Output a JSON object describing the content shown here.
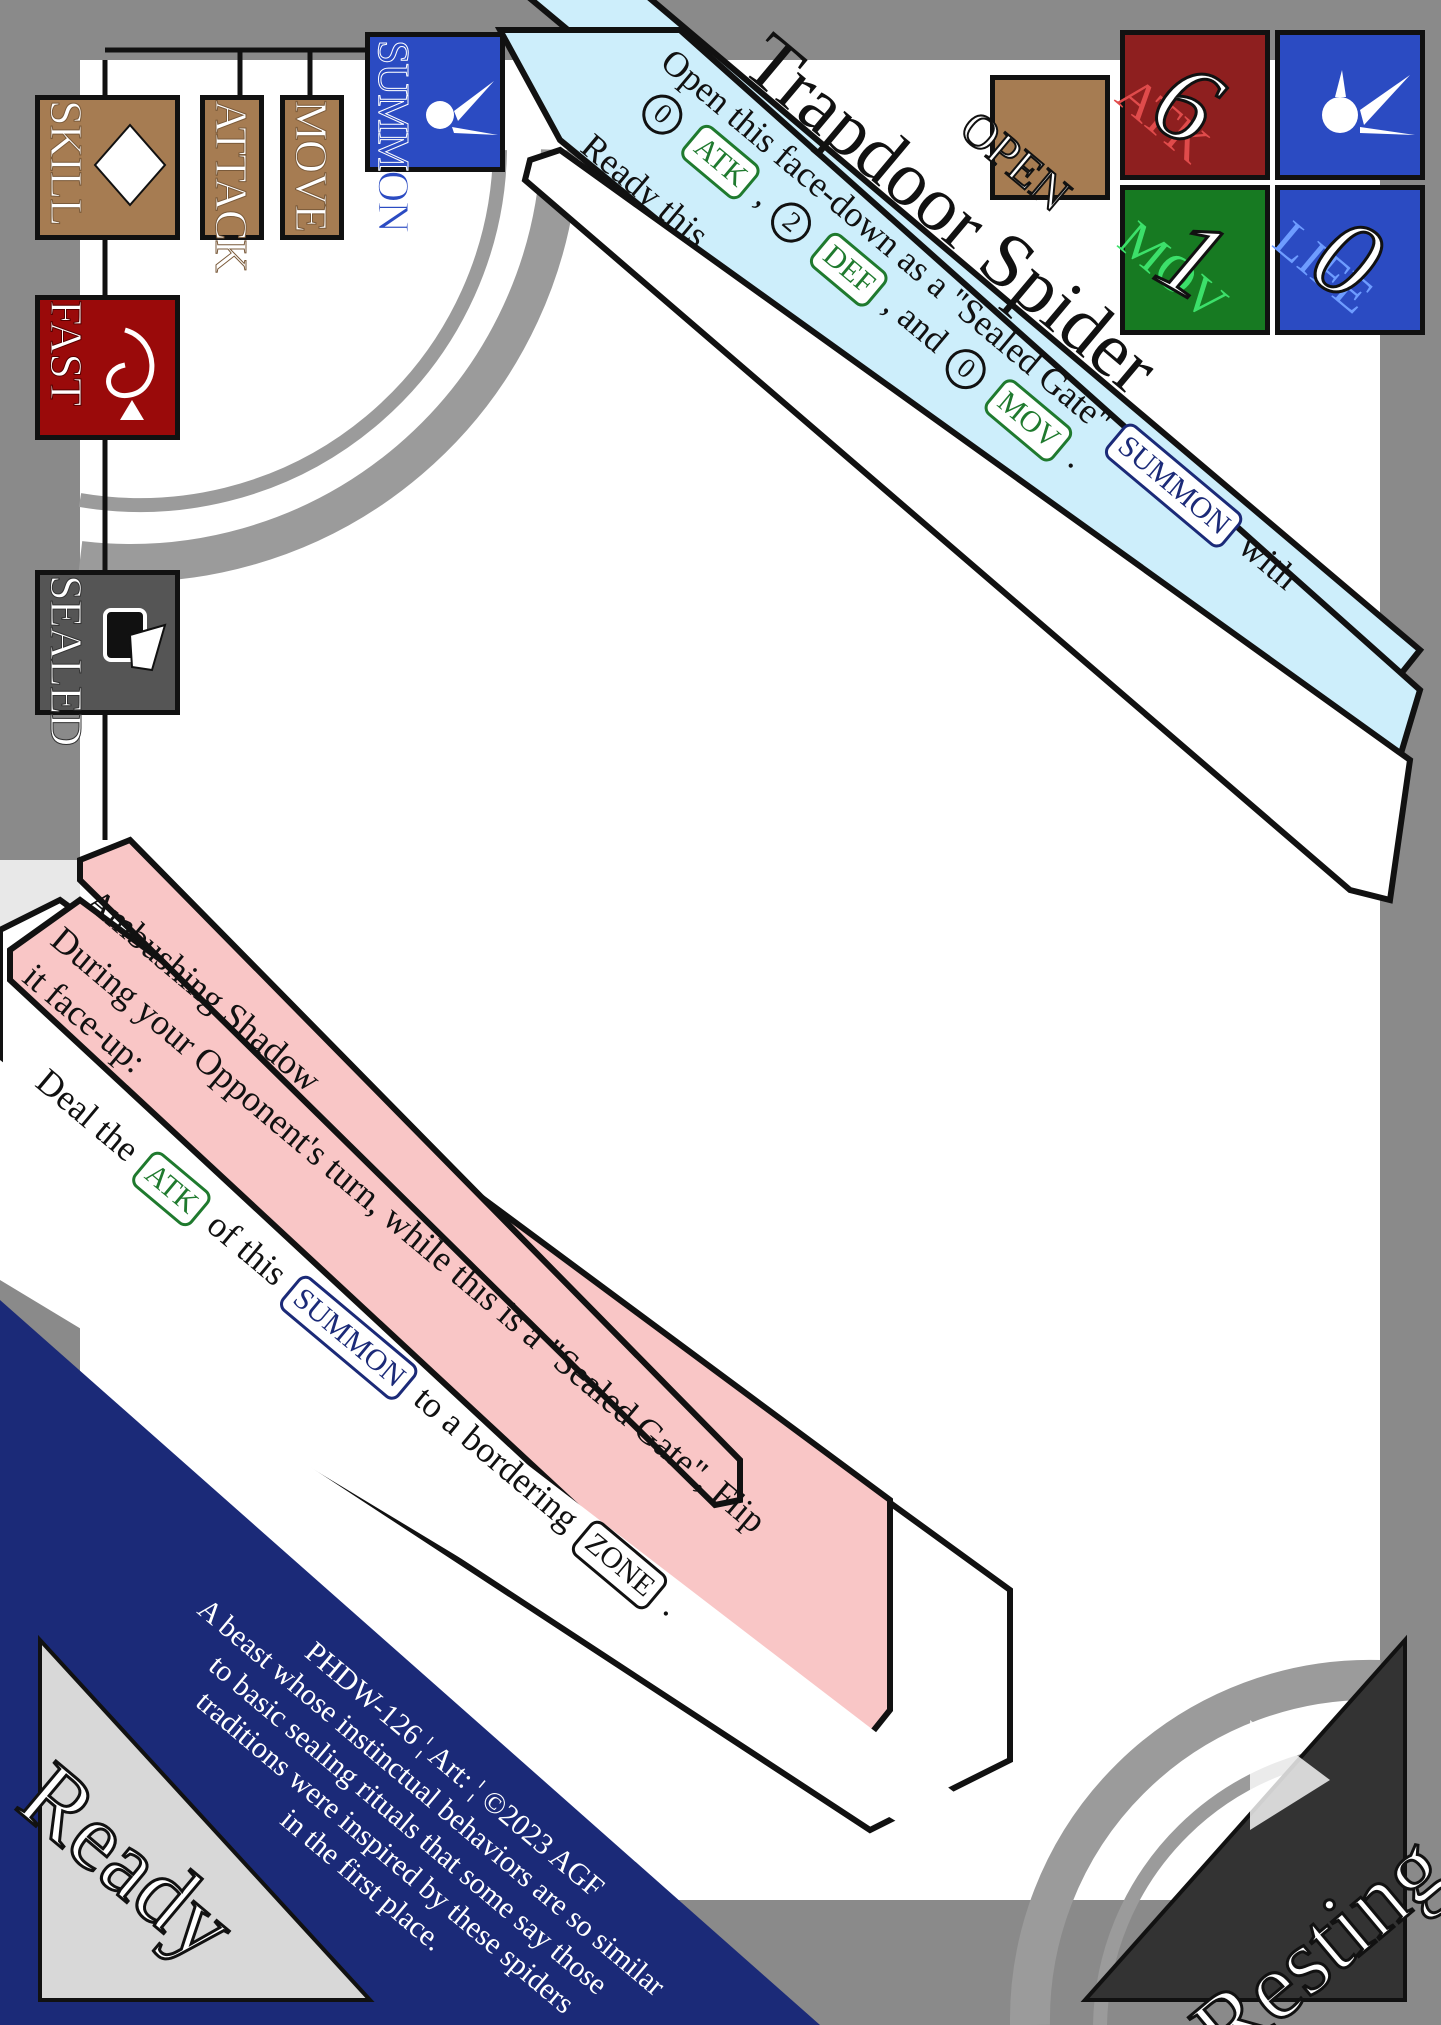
{
  "card": {
    "name": "Trapdoor Spider",
    "ribbon_text": "Open this face-down as a \"Sealed Gate\"",
    "ribbon_with": "with",
    "ribbon_cost_line": "ATK, DEF, and MOV.",
    "ribbon_numbers": [
      "0",
      "2",
      "0"
    ],
    "chip_labels": {
      "summon": "SUMMON",
      "atk": "ATK",
      "def": "DEF",
      "mov": "MOV",
      "zone": "ZONE"
    },
    "ribbon_sep": [
      ",",
      ", and",
      "."
    ],
    "ready_this": "Ready this.",
    "ability_name": "Ambushing Shadow",
    "ability_condition_1": "During your Opponent's turn, while this is a \"Sealed Gate\", Flip",
    "ability_condition_2": "it face-up:",
    "ability_effect_parts": [
      "Deal the",
      "of this",
      "to a bordering",
      "."
    ],
    "flavor": [
      "PHDW-126 ¦ Art: ¦ ©2023 AGF",
      "A beast whose instinctual behaviors are so similar",
      "to basic sealing rituals that some say those",
      "traditions were inspired by these spiders",
      "in the first place."
    ],
    "ready_label": "Ready",
    "resting_label": "Resting"
  },
  "stats": {
    "open_label": "OPEN",
    "atk_label": "ATK",
    "atk_value": "6",
    "mov_label": "MOV",
    "mov_value": "1",
    "life_label": "LIFE",
    "life_value": "0"
  },
  "phases": {
    "summon": "SUMMON",
    "move": "MOVE",
    "attack": "ATTACK",
    "skill": "SKILL",
    "fast": "FAST",
    "sealed": "SEALED"
  },
  "colors": {
    "frame": "#8a8a8a",
    "ribbon_blue": "#cdeefb",
    "ability_pink": "#f9c6c6",
    "ready_navy": "#1b2a78",
    "atk_red": "#8e1f1f",
    "mov_green": "#177a22",
    "life_blue": "#2b4bc2",
    "open_brown": "#a67c52",
    "skill_brown": "#a67c52",
    "fast_red": "#9a0a0a",
    "sealed_gray": "#555555",
    "chip_green": "#1f7a2e",
    "chip_navy": "#1b2a78"
  },
  "icons": [
    "summon-fairy-icon",
    "diamond-icon",
    "fast-swirl-icon",
    "sealed-card-icon",
    "triangle-arrow-icon"
  ]
}
